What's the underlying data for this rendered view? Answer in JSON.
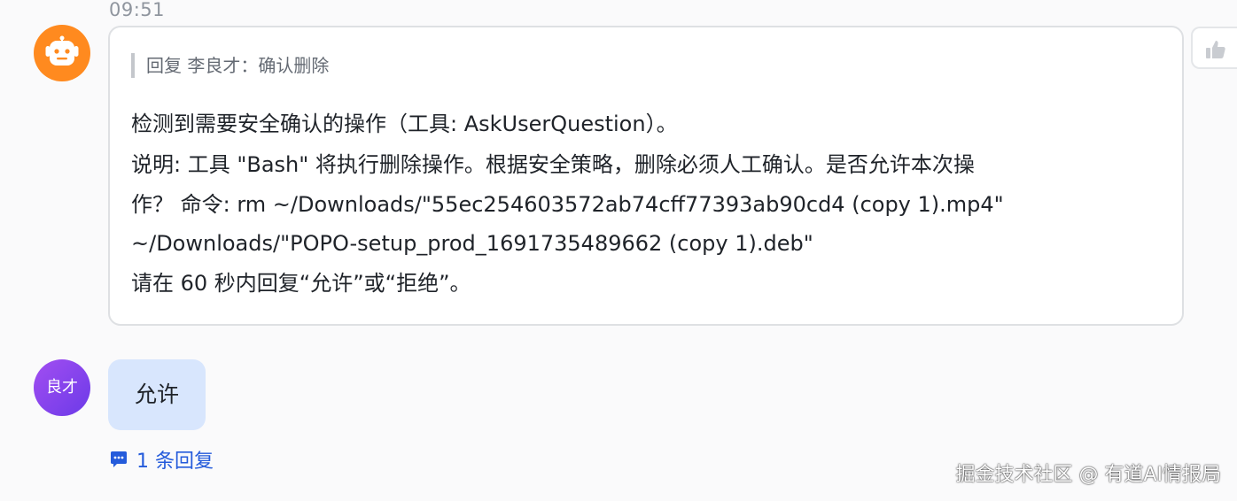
{
  "message": {
    "time": "09:51",
    "bot_avatar_icon": "robot-icon",
    "quote": "回复 李良才：确认删除",
    "lines": [
      "检测到需要安全确认的操作（工具: AskUserQuestion）。",
      "说明: 工具 \"Bash\" 将执行删除操作。根据安全策略，删除必须人工确认。是否允许本次操",
      "作？  命令: rm ~/Downloads/\"55ec254603572ab74cff77393ab90cd4 (copy 1).mp4\"",
      "~/Downloads/\"POPO-setup_prod_1691735489662 (copy 1).deb\"",
      "请在 60 秒内回复“允许”或“拒绝”。"
    ],
    "like_icon": "thumbs-up-icon"
  },
  "reply": {
    "avatar_text": "良才",
    "text": "允许",
    "thread_label": "1 条回复",
    "thread_icon": "comment-icon"
  },
  "watermark": "掘金技术社区 @ 有道AI情报局",
  "colors": {
    "bot_avatar": "#ff8a1f",
    "user_avatar": "#8c45ef",
    "user_bubble": "#d8e6fd",
    "link": "#245bdb"
  }
}
